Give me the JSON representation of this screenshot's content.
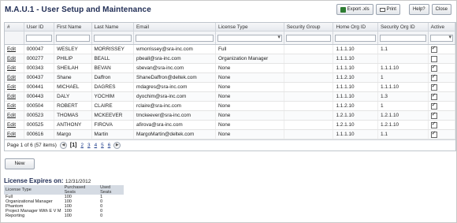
{
  "title": "M.A.U.1 - User Setup and Maintenance",
  "toolbar": {
    "export_label": "Export .xls",
    "print_label": "Print",
    "help_label": "Help?",
    "close_label": "Close"
  },
  "grid": {
    "columns": [
      "#",
      "User ID",
      "First Name",
      "Last Name",
      "Email",
      "License Type",
      "Security Group",
      "Home Org ID",
      "Security Org ID",
      "Active"
    ],
    "edit_label": "Edit",
    "rows": [
      {
        "user_id": "000047",
        "first": "WESLEY",
        "last": "MORRISSEY",
        "email": "wmorrissey@sra-inc.com",
        "license": "Full",
        "group": "",
        "home_org": "1.1.1.10",
        "sec_org": "1.1",
        "active": true
      },
      {
        "user_id": "000277",
        "first": "PHILIP",
        "last": "BEALL",
        "email": "pbeall@sra-inc.com",
        "license": "Organization Manager",
        "group": "",
        "home_org": "1.1.1.10",
        "sec_org": "",
        "active": false
      },
      {
        "user_id": "000343",
        "first": "SHEILAH",
        "last": "BEVAN",
        "email": "sbevan@sra-inc.com",
        "license": "None",
        "group": "",
        "home_org": "1.1.1.10",
        "sec_org": "1.1.1.10",
        "active": true
      },
      {
        "user_id": "000437",
        "first": "Shane",
        "last": "Daffron",
        "email": "ShaneDaffron@deltek.com",
        "license": "None",
        "group": "",
        "home_org": "1.1.2.10",
        "sec_org": "1",
        "active": true
      },
      {
        "user_id": "000441",
        "first": "MICHAEL",
        "last": "DAGRES",
        "email": "mdagres@sra-inc.com",
        "license": "None",
        "group": "",
        "home_org": "1.1.1.10",
        "sec_org": "1.1.1.10",
        "active": true
      },
      {
        "user_id": "000443",
        "first": "DALY",
        "last": "YOCHIM",
        "email": "dyochim@sra-inc.com",
        "license": "None",
        "group": "",
        "home_org": "1.1.1.10",
        "sec_org": "1.3",
        "active": true
      },
      {
        "user_id": "000504",
        "first": "ROBERT",
        "last": "CLAIRE",
        "email": "rclaire@sra-inc.com",
        "license": "None",
        "group": "",
        "home_org": "1.1.2.10",
        "sec_org": "1",
        "active": true
      },
      {
        "user_id": "000523",
        "first": "THOMAS",
        "last": "MCKEEVER",
        "email": "tmckeever@sra-inc.com",
        "license": "None",
        "group": "",
        "home_org": "1.2.1.10",
        "sec_org": "1.2.1.10",
        "active": true
      },
      {
        "user_id": "000525",
        "first": "ANTHONY",
        "last": "FIROVA",
        "email": "afirova@sra-inc.com",
        "license": "None",
        "group": "",
        "home_org": "1.2.1.10",
        "sec_org": "1.2.1.10",
        "active": true
      },
      {
        "user_id": "000616",
        "first": "Margo",
        "last": "Martin",
        "email": "MargoMartin@deltek.com",
        "license": "None",
        "group": "",
        "home_org": "1.1.1.10",
        "sec_org": "1.1",
        "active": true
      }
    ]
  },
  "pager": {
    "summary": "Page 1 of 6 (57 items)",
    "prev_icon": "chevron-left-icon",
    "next_icon": "chevron-right-icon",
    "pages": [
      "[1]",
      "2",
      "3",
      "4",
      "5",
      "6"
    ],
    "current": "[1]"
  },
  "new_button": "New",
  "license": {
    "heading": "License Expires on:",
    "date": "12/31/2012",
    "headers": [
      "License Type",
      "Purchased Seats",
      "Used Seats"
    ],
    "rows": [
      {
        "type": "Full",
        "purchased": "100",
        "used": "1"
      },
      {
        "type": "Organizational Manager",
        "purchased": "100",
        "used": "0"
      },
      {
        "type": "Phantom",
        "purchased": "100",
        "used": "0"
      },
      {
        "type": "Project Manager With E V M",
        "purchased": "100",
        "used": "0"
      },
      {
        "type": "Reporting",
        "purchased": "100",
        "used": "0"
      }
    ]
  }
}
